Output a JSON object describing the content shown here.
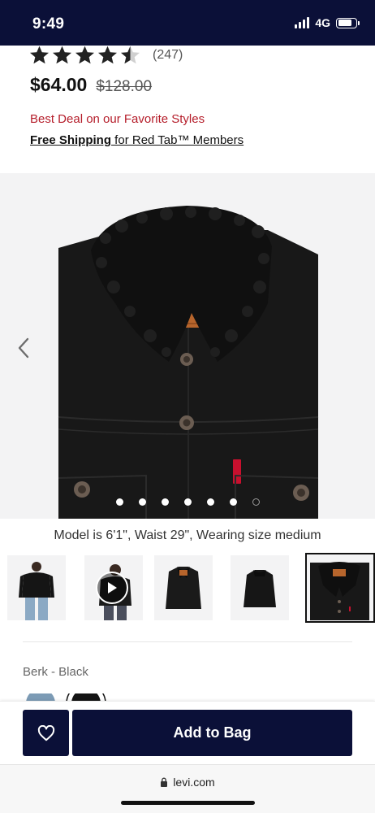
{
  "status_bar": {
    "time": "9:49",
    "network": "4G",
    "battery_level": 0.8
  },
  "product": {
    "rating": 4.5,
    "review_count": "(247)",
    "price": "$64.00",
    "original_price": "$128.00",
    "deal_text": "Best Deal on our Favorite Styles",
    "shipping_strong": "Free Shipping",
    "shipping_rest": " for Red Tab™ Members",
    "model_caption": "Model is 6'1\", Waist 29\", Wearing size medium",
    "color_label": "Berk - Black"
  },
  "gallery": {
    "image_count": 7,
    "active_index": 6
  },
  "thumbnails": {
    "selected_index": 4,
    "video_index": 1
  },
  "actions": {
    "add_to_bag": "Add to Bag"
  },
  "browser": {
    "url": "levi.com"
  },
  "colors": {
    "brand_navy": "#0b1038",
    "deal_red": "#b51d2a",
    "tab_red": "#c8102e"
  },
  "icons": {
    "back": "chevron-left-icon",
    "wishlist": "heart-outline-icon",
    "lock": "lock-icon",
    "play": "play-icon"
  }
}
